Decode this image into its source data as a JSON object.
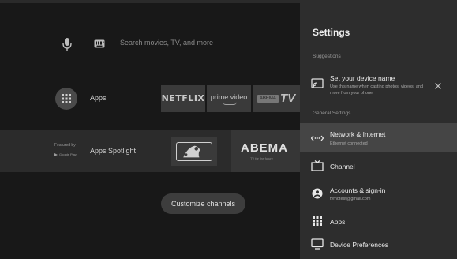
{
  "home": {
    "search_placeholder": "Search movies, TV, and more",
    "apps_label": "Apps",
    "apps_tiles": [
      {
        "name": "netflix",
        "label": "NETFLIX"
      },
      {
        "name": "prime-video",
        "label": "prime video"
      },
      {
        "name": "abema-tv",
        "label": "TV",
        "badge": "ABEMA"
      }
    ],
    "spotlight": {
      "featured_by": "Featured by",
      "google_play": "Google Play",
      "label": "Apps Spotlight",
      "tiles": [
        {
          "name": "mlb"
        },
        {
          "name": "abema",
          "label": "ABEMA",
          "sub": "TV for the future"
        }
      ]
    },
    "customize_label": "Customize channels"
  },
  "settings": {
    "title": "Settings",
    "suggestions_label": "Suggestions",
    "suggestion": {
      "icon": "cast-icon",
      "title": "Set your device name",
      "sub": "Use this name when casting photos, videos, and more from your phone"
    },
    "general_label": "General Settings",
    "items": [
      {
        "icon": "network-icon",
        "title": "Network & Internet",
        "sub": "Ethernet connected",
        "selected": true
      },
      {
        "icon": "tv-icon",
        "title": "Channel",
        "sub": ""
      },
      {
        "icon": "account-icon",
        "title": "Accounts & sign-in",
        "sub": "tvmdtest@gmail.com"
      },
      {
        "icon": "apps-grid-icon",
        "title": "Apps",
        "sub": ""
      },
      {
        "icon": "monitor-icon",
        "title": "Device Preferences",
        "sub": ""
      }
    ]
  },
  "colors": {
    "home_bg": "#181818",
    "settings_bg": "#2d2d2d",
    "selected_item_bg": "#454545",
    "text_primary": "#ececec",
    "text_secondary": "#a8a8a8"
  }
}
